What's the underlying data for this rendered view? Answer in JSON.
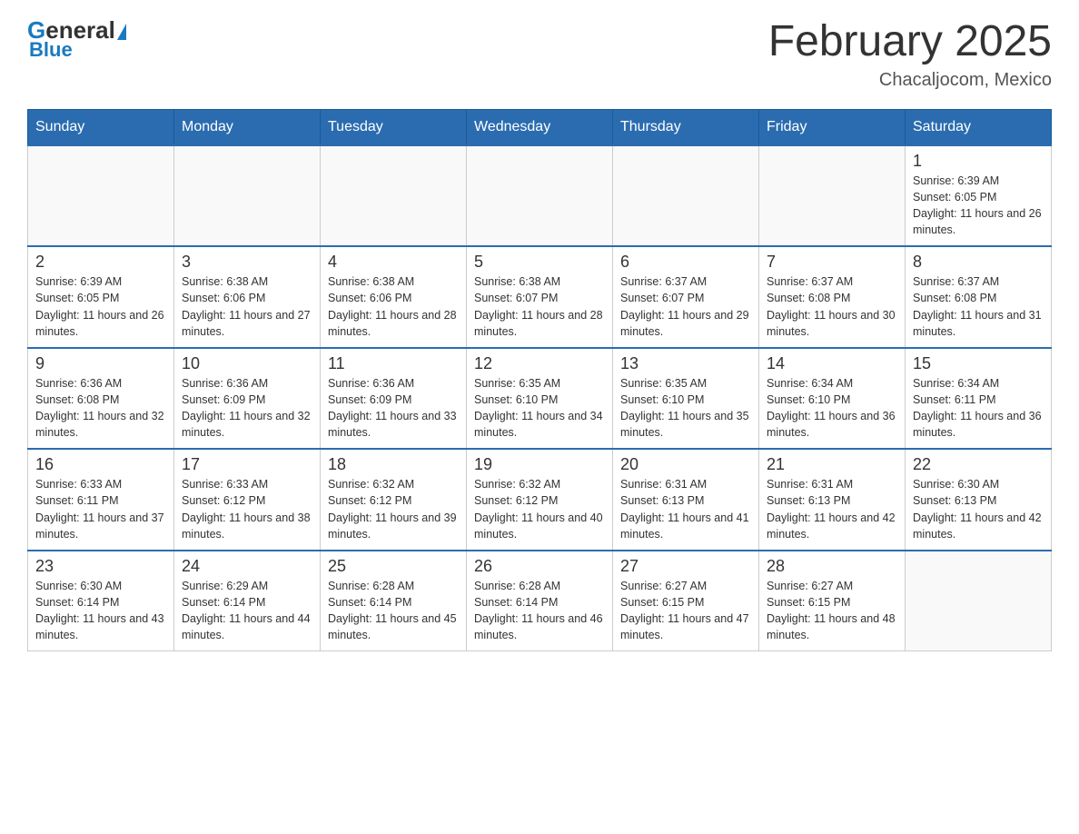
{
  "header": {
    "logo_general": "General",
    "logo_blue": "Blue",
    "month_title": "February 2025",
    "location": "Chacaljocom, Mexico"
  },
  "days_of_week": [
    "Sunday",
    "Monday",
    "Tuesday",
    "Wednesday",
    "Thursday",
    "Friday",
    "Saturday"
  ],
  "weeks": [
    [
      {
        "day": "",
        "info": ""
      },
      {
        "day": "",
        "info": ""
      },
      {
        "day": "",
        "info": ""
      },
      {
        "day": "",
        "info": ""
      },
      {
        "day": "",
        "info": ""
      },
      {
        "day": "",
        "info": ""
      },
      {
        "day": "1",
        "info": "Sunrise: 6:39 AM\nSunset: 6:05 PM\nDaylight: 11 hours and 26 minutes."
      }
    ],
    [
      {
        "day": "2",
        "info": "Sunrise: 6:39 AM\nSunset: 6:05 PM\nDaylight: 11 hours and 26 minutes."
      },
      {
        "day": "3",
        "info": "Sunrise: 6:38 AM\nSunset: 6:06 PM\nDaylight: 11 hours and 27 minutes."
      },
      {
        "day": "4",
        "info": "Sunrise: 6:38 AM\nSunset: 6:06 PM\nDaylight: 11 hours and 28 minutes."
      },
      {
        "day": "5",
        "info": "Sunrise: 6:38 AM\nSunset: 6:07 PM\nDaylight: 11 hours and 28 minutes."
      },
      {
        "day": "6",
        "info": "Sunrise: 6:37 AM\nSunset: 6:07 PM\nDaylight: 11 hours and 29 minutes."
      },
      {
        "day": "7",
        "info": "Sunrise: 6:37 AM\nSunset: 6:08 PM\nDaylight: 11 hours and 30 minutes."
      },
      {
        "day": "8",
        "info": "Sunrise: 6:37 AM\nSunset: 6:08 PM\nDaylight: 11 hours and 31 minutes."
      }
    ],
    [
      {
        "day": "9",
        "info": "Sunrise: 6:36 AM\nSunset: 6:08 PM\nDaylight: 11 hours and 32 minutes."
      },
      {
        "day": "10",
        "info": "Sunrise: 6:36 AM\nSunset: 6:09 PM\nDaylight: 11 hours and 32 minutes."
      },
      {
        "day": "11",
        "info": "Sunrise: 6:36 AM\nSunset: 6:09 PM\nDaylight: 11 hours and 33 minutes."
      },
      {
        "day": "12",
        "info": "Sunrise: 6:35 AM\nSunset: 6:10 PM\nDaylight: 11 hours and 34 minutes."
      },
      {
        "day": "13",
        "info": "Sunrise: 6:35 AM\nSunset: 6:10 PM\nDaylight: 11 hours and 35 minutes."
      },
      {
        "day": "14",
        "info": "Sunrise: 6:34 AM\nSunset: 6:10 PM\nDaylight: 11 hours and 36 minutes."
      },
      {
        "day": "15",
        "info": "Sunrise: 6:34 AM\nSunset: 6:11 PM\nDaylight: 11 hours and 36 minutes."
      }
    ],
    [
      {
        "day": "16",
        "info": "Sunrise: 6:33 AM\nSunset: 6:11 PM\nDaylight: 11 hours and 37 minutes."
      },
      {
        "day": "17",
        "info": "Sunrise: 6:33 AM\nSunset: 6:12 PM\nDaylight: 11 hours and 38 minutes."
      },
      {
        "day": "18",
        "info": "Sunrise: 6:32 AM\nSunset: 6:12 PM\nDaylight: 11 hours and 39 minutes."
      },
      {
        "day": "19",
        "info": "Sunrise: 6:32 AM\nSunset: 6:12 PM\nDaylight: 11 hours and 40 minutes."
      },
      {
        "day": "20",
        "info": "Sunrise: 6:31 AM\nSunset: 6:13 PM\nDaylight: 11 hours and 41 minutes."
      },
      {
        "day": "21",
        "info": "Sunrise: 6:31 AM\nSunset: 6:13 PM\nDaylight: 11 hours and 42 minutes."
      },
      {
        "day": "22",
        "info": "Sunrise: 6:30 AM\nSunset: 6:13 PM\nDaylight: 11 hours and 42 minutes."
      }
    ],
    [
      {
        "day": "23",
        "info": "Sunrise: 6:30 AM\nSunset: 6:14 PM\nDaylight: 11 hours and 43 minutes."
      },
      {
        "day": "24",
        "info": "Sunrise: 6:29 AM\nSunset: 6:14 PM\nDaylight: 11 hours and 44 minutes."
      },
      {
        "day": "25",
        "info": "Sunrise: 6:28 AM\nSunset: 6:14 PM\nDaylight: 11 hours and 45 minutes."
      },
      {
        "day": "26",
        "info": "Sunrise: 6:28 AM\nSunset: 6:14 PM\nDaylight: 11 hours and 46 minutes."
      },
      {
        "day": "27",
        "info": "Sunrise: 6:27 AM\nSunset: 6:15 PM\nDaylight: 11 hours and 47 minutes."
      },
      {
        "day": "28",
        "info": "Sunrise: 6:27 AM\nSunset: 6:15 PM\nDaylight: 11 hours and 48 minutes."
      },
      {
        "day": "",
        "info": ""
      }
    ]
  ]
}
